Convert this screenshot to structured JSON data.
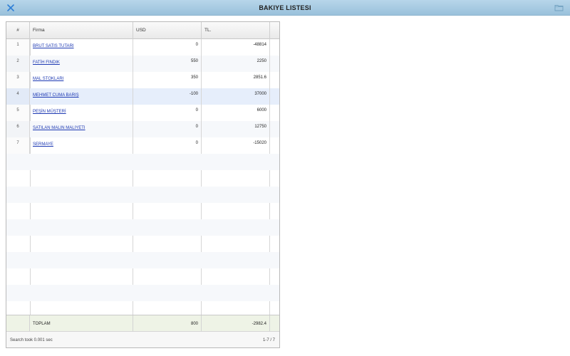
{
  "window": {
    "title": "BAKIYE LISTESI"
  },
  "icons": {
    "close": "close-x-icon",
    "folder": "folder-icon"
  },
  "colors": {
    "titlebar": "#a8cde3",
    "accent": "#2f7fd6",
    "link": "#1d39b3",
    "total_row": "#eef3e6",
    "selected_row": "#e6eefb"
  },
  "grid": {
    "columns": [
      "#",
      "Firma",
      "USD",
      "TL."
    ],
    "rows": [
      {
        "num": "1",
        "firma": "BRUT SATIS TUTARI",
        "usd": "0",
        "tl": "-48814"
      },
      {
        "num": "2",
        "firma": "FATİH FINDIK",
        "usd": "550",
        "tl": "2250"
      },
      {
        "num": "3",
        "firma": "MAL STOKLARI",
        "usd": "350",
        "tl": "2851.6"
      },
      {
        "num": "4",
        "firma": "MEHMET CUMA BARIŞ",
        "usd": "-100",
        "tl": "37000"
      },
      {
        "num": "5",
        "firma": "PEŞİN MÜŞTERİ",
        "usd": "0",
        "tl": "6000"
      },
      {
        "num": "6",
        "firma": "SATILAN MALIN MALIYETI",
        "usd": "0",
        "tl": "12750"
      },
      {
        "num": "7",
        "firma": "SERMAYE",
        "usd": "0",
        "tl": "-15020"
      }
    ],
    "total": {
      "label": "TOPLAM",
      "usd": "800",
      "tl": "-2982.4"
    },
    "status": {
      "search": "Search took 0.001 sec",
      "range": "1-7 / 7"
    }
  }
}
